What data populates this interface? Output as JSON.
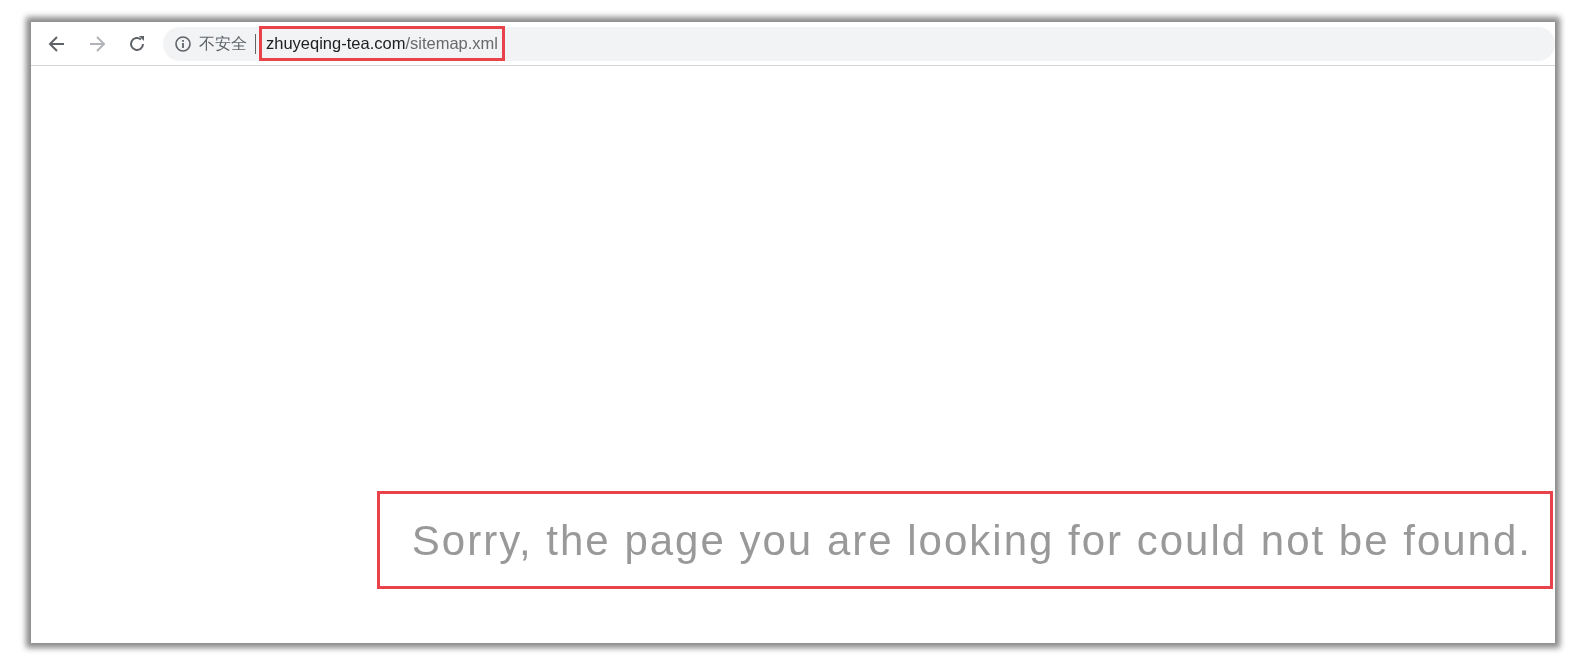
{
  "browser": {
    "back_enabled": true,
    "forward_enabled": false,
    "security_label": "不安全",
    "url": {
      "host": "zhuyeqing-tea.com",
      "path": "/sitemap.xml",
      "highlighted": true
    }
  },
  "page": {
    "message": "Sorry, the page you are looking for could not be found.",
    "highlighted": true
  }
}
